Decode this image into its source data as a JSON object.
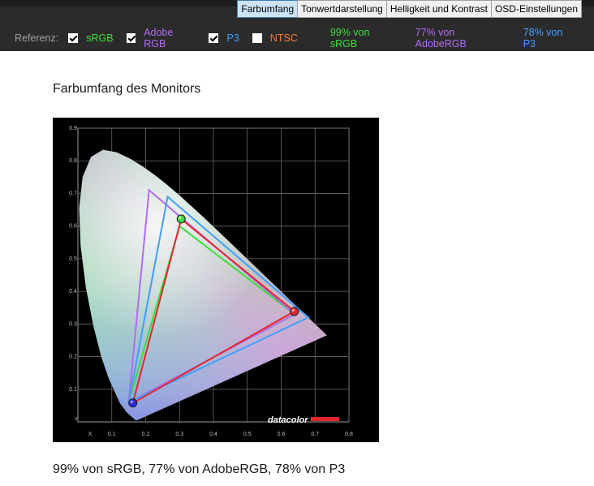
{
  "tabs": [
    {
      "label": "Farbumfang",
      "active": true
    },
    {
      "label": "Tonwertdarstellung",
      "active": false
    },
    {
      "label": "Helligkeit und Kontrast",
      "active": false
    },
    {
      "label": "OSD-Einstellungen",
      "active": false
    }
  ],
  "reference": {
    "label": "Referenz:",
    "options": [
      {
        "name": "sRGB",
        "checked": true,
        "color": "#3ddc3d"
      },
      {
        "name": "Adobe RGB",
        "checked": true,
        "color": "#b26cf0"
      },
      {
        "name": "P3",
        "checked": true,
        "color": "#3f9fff"
      },
      {
        "name": "NTSC",
        "checked": false,
        "color": "#ff7a3a"
      }
    ],
    "stats": [
      {
        "text": "99% von sRGB",
        "color": "#3ddc3d"
      },
      {
        "text": "77% von AdobeRGB",
        "color": "#b26cf0"
      },
      {
        "text": "78% von P3",
        "color": "#3f9fff"
      }
    ]
  },
  "main": {
    "title": "Farbumfang des Monitors",
    "caption": "99% von sRGB, 77% von AdobeRGB, 78% von P3"
  },
  "chart_data": {
    "type": "scatter",
    "subtype": "cie-1931-chromaticity",
    "xlabel": "X",
    "ylabel": "Y",
    "xlim": [
      0,
      0.8
    ],
    "ylim": [
      0,
      0.9
    ],
    "x_ticks": [
      "0.1",
      "0.2",
      "0.3",
      "0.4",
      "0.5",
      "0.6",
      "0.7",
      "0.8"
    ],
    "y_ticks": [
      "0.1",
      "0.2",
      "0.3",
      "0.4",
      "0.5",
      "0.6",
      "0.7",
      "0.8",
      "0.9"
    ],
    "grid": true,
    "background": "#000000",
    "logo_text": "datacolor",
    "logo_bar_color": "#e3262e",
    "series": [
      {
        "color": "#3ddc3d",
        "points": [
          [
            0.64,
            0.33
          ],
          [
            0.3,
            0.6
          ],
          [
            0.15,
            0.06
          ]
        ]
      },
      {
        "color": "#b26cf0",
        "points": [
          [
            0.64,
            0.33
          ],
          [
            0.21,
            0.71
          ],
          [
            0.15,
            0.06
          ]
        ]
      },
      {
        "color": "#3f9fff",
        "points": [
          [
            0.68,
            0.32
          ],
          [
            0.265,
            0.69
          ],
          [
            0.15,
            0.06
          ]
        ]
      },
      {
        "color": "#e3262e",
        "points": [
          [
            0.6388,
            0.3385
          ],
          [
            0.3048,
            0.6218
          ],
          [
            0.1622,
            0.058
          ]
        ]
      }
    ],
    "measured_points": [
      {
        "x": 0.6388,
        "y": 0.3385,
        "color": "#e3262e"
      },
      {
        "x": 0.3048,
        "y": 0.6218,
        "color": "#3ddc3d"
      },
      {
        "x": 0.1622,
        "y": 0.058,
        "color": "#2a2ae8"
      }
    ]
  }
}
